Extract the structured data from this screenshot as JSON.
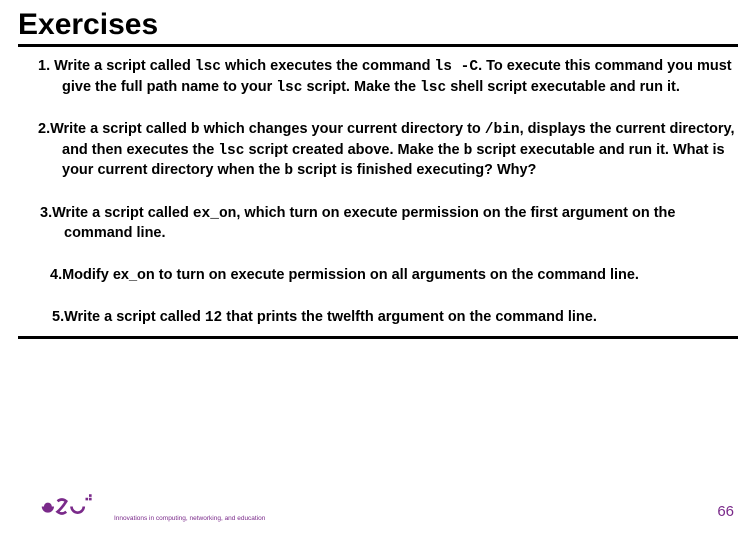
{
  "title": "Exercises",
  "exercises": {
    "e1": {
      "num": "1.",
      "t1": " Write a script called ",
      "c1": "lsc",
      "t2": " which executes the command ",
      "c2": "ls -C",
      "t3": ". To execute this command you must give the full path name to your ",
      "c3": "lsc",
      "t4": " script. Make the ",
      "c4": "lsc",
      "t5": " shell script executable and run it."
    },
    "e2": {
      "num": "2.",
      "t1": "Write a script called ",
      "c1": "b",
      "t2": " which changes your current directory to ",
      "c2": "/bin",
      "t3": ", displays the current directory, and then executes the ",
      "c3": "lsc",
      "t4": " script created above. Make the ",
      "c4": "b",
      "t5": " script executable and run it. What is your current directory when the ",
      "c5": "b",
      "t6": " script is finished executing? Why?"
    },
    "e3": {
      "num": "3.",
      "t1": "Write a script called ",
      "c1": "ex_on",
      "t2": ", which turn on execute permission on the first argument on the command line."
    },
    "e4": {
      "num": "4.",
      "t1": "Modify ex_on to turn on execute permission on all arguments on the command line."
    },
    "e5": {
      "num": "5.",
      "t1": "Write a script called ",
      "c1": "12",
      "t2": " that prints the twelfth argument on the command line."
    }
  },
  "logo": {
    "tagline": "Innovations in computing, networking, and education"
  },
  "page_number": "66"
}
